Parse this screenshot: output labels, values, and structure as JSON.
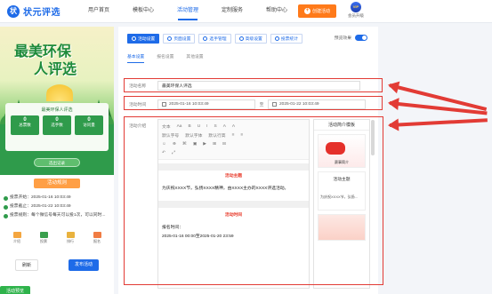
{
  "brand": {
    "logo_glyph": "状",
    "name": "状元评选"
  },
  "nav": [
    {
      "label": "用户首页",
      "active": false
    },
    {
      "label": "模板中心",
      "active": false
    },
    {
      "label": "活动管理",
      "active": true
    },
    {
      "label": "定制服务",
      "active": false
    },
    {
      "label": "帮助中心",
      "active": false
    }
  ],
  "header": {
    "create_label": "创建活动",
    "vip_badge": "VIP",
    "vip_label": "会员升级"
  },
  "preview": {
    "poster_title_line1": "最美环保",
    "poster_title_line2": "人评选",
    "vote_title": "最美环保人评选",
    "stats": [
      {
        "value": "0",
        "label": "总票数"
      },
      {
        "value": "0",
        "label": "选手数"
      },
      {
        "value": "0",
        "label": "访问量"
      }
    ],
    "record_label": "选出记录",
    "rules_tab": "活动规则",
    "rules": [
      "投票开始：2025-01-16 10:03:49",
      "投票截止：2025-01-22 10:03:49",
      "投票规则：每个微信号每天可以投1次，可以同时..."
    ],
    "bottom_tabs": [
      "介绍",
      "投票",
      "排行",
      "报名"
    ],
    "actions": {
      "refresh": "刷新",
      "publish": "发布活动",
      "preview": "活动预览"
    }
  },
  "tools": [
    {
      "label": "活动设置",
      "active": true
    },
    {
      "label": "页面设置",
      "active": false
    },
    {
      "label": "选手管理",
      "active": false
    },
    {
      "label": "高级设置",
      "active": false
    },
    {
      "label": "投票统计",
      "active": false
    }
  ],
  "preview_toggle": {
    "label": "预览效果",
    "on": true
  },
  "subtabs": [
    {
      "label": "基本设置",
      "active": true
    },
    {
      "label": "报名设置",
      "active": false
    },
    {
      "label": "其他设置",
      "active": false
    }
  ],
  "form": {
    "name_label": "活动名称",
    "name_value": "最美环保人评选",
    "time_label": "活动时间",
    "start": "2025-01-16 10:03:49",
    "to": "至",
    "end": "2025-01-22 10:03:49",
    "intro_label": "活动介绍"
  },
  "editor": {
    "toolbar_rows": [
      [
        "文本",
        "Aa",
        "B",
        "U",
        "I",
        "S",
        "A",
        "A"
      ],
      [
        "默认字号",
        "默认字体",
        "默认行高",
        "≡",
        "≡"
      ],
      [
        "☺",
        "⊕",
        "⌘",
        "▣",
        "▶",
        "⊞",
        "⊟"
      ],
      [
        "↶",
        "⤢"
      ]
    ],
    "heading1": "活动主题",
    "body1": "为庆祝XXXX节，弘扬XXXX精神，由XXXX主办的XXXX评选活动。",
    "heading2": "活动时间",
    "body2": "报名时间：",
    "body3": "2025-01-16 00:00至2025-01-20 23:59"
  },
  "templates": {
    "title": "活动简介模板",
    "items": [
      {
        "caption": "赛事简介"
      },
      {
        "title": "活动主题",
        "line": "为庆祝XXXX节，弘扬..."
      },
      {
        "caption": ""
      }
    ]
  },
  "highlight_color": "#e23b35",
  "accent_color": "#1e6be8"
}
